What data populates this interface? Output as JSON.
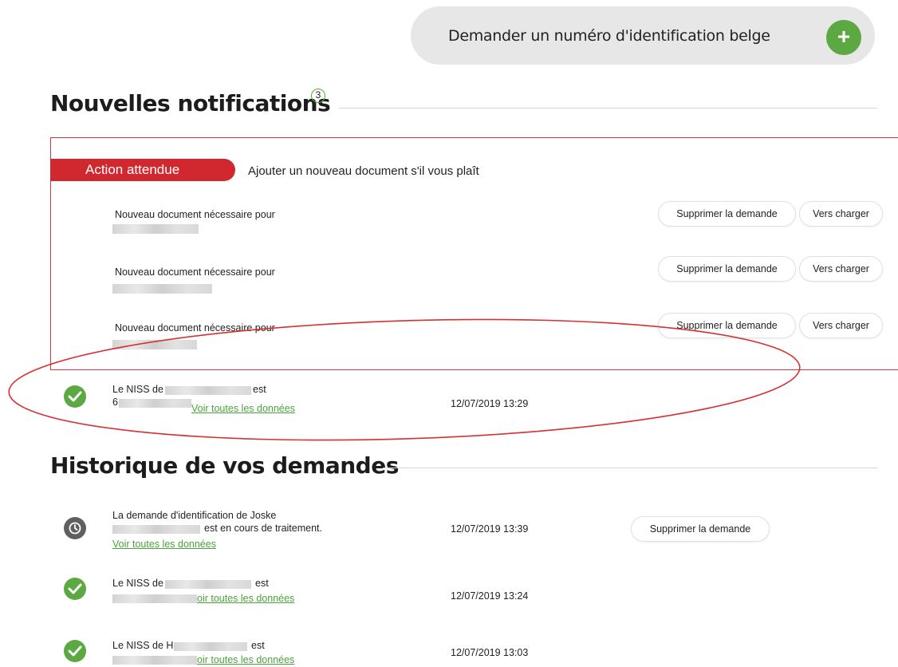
{
  "request": {
    "label": "Demander un numéro d'identification belge",
    "plus_symbol": "+"
  },
  "notifications": {
    "title": "Nouvelles notifications",
    "count": "3",
    "action_badge": "Action attendue",
    "action_text": "Ajouter un nouveau document s'il vous plaît",
    "items": [
      {
        "label": "Nouveau document nécessaire pour",
        "delete_label": "Supprimer la demande",
        "upload_label": "Vers charger"
      },
      {
        "label": "Nouveau document nécessaire pour",
        "delete_label": "Supprimer la demande",
        "upload_label": "Vers charger"
      },
      {
        "label": "Nouveau document nécessaire pour",
        "delete_label": "Supprimer la demande",
        "upload_label": "Vers charger"
      }
    ],
    "status": {
      "text_prefix": "Le NISS de",
      "text_suffix": "est",
      "line2_prefix": "6",
      "link": "Voir toutes les données",
      "date": "12/07/2019 13:29"
    }
  },
  "history": {
    "title": "Historique de vos demandes",
    "items": [
      {
        "line1": "La demande d'identification de Joske",
        "line2": "est en cours de traitement.",
        "link": "Voir toutes les données",
        "date": "12/07/2019 13:39",
        "delete_label": "Supprimer la demande"
      },
      {
        "line1_prefix": "Le NISS de",
        "line1_suffix": "est",
        "link": "oir toutes les données",
        "date": "12/07/2019 13:24"
      },
      {
        "line1_prefix": "Le NISS de H",
        "line1_suffix": "est",
        "link": "oir toutes les données",
        "date": "12/07/2019 13:03"
      }
    ]
  },
  "colors": {
    "green": "#5ca842",
    "red": "#d0282e",
    "grey": "#e6e7e6"
  }
}
